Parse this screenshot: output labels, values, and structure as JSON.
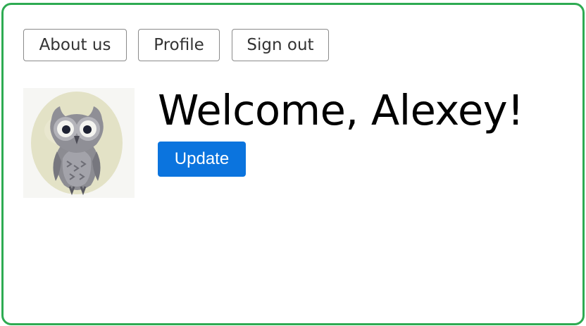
{
  "nav": {
    "about_label": "About us",
    "profile_label": "Profile",
    "signout_label": "Sign out"
  },
  "profile": {
    "welcome_text": "Welcome, Alexey!",
    "avatar_icon": "owl-avatar-icon",
    "update_label": "Update"
  },
  "colors": {
    "frame_border": "#2eab52",
    "primary_button": "#0b74de"
  }
}
